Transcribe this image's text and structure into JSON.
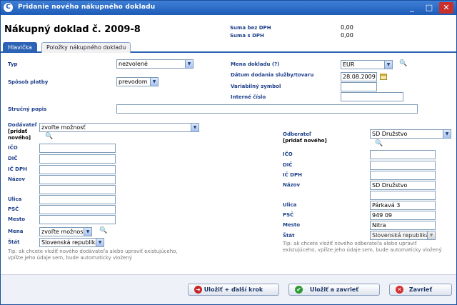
{
  "window": {
    "title": "Pridanie nového nákupného dokladu",
    "logo": "C",
    "minimize": "_",
    "maximize": "□",
    "close": "✕"
  },
  "header": {
    "doc_title": "Nákupný doklad č. 2009-8",
    "sum_without_vat_label": "Suma bez DPH",
    "sum_without_vat_value": "0,00",
    "sum_with_vat_label": "Suma s DPH",
    "sum_with_vat_value": "0,00"
  },
  "tabs": [
    {
      "label": "Hlavička",
      "active": true
    },
    {
      "label": "Položky nákupného dokladu",
      "active": false
    }
  ],
  "form": {
    "type_label": "Typ",
    "type_value": "nezvolené",
    "payment_label": "Spôsob platby",
    "payment_value": "prevodom",
    "currency_label": "Mena dokladu",
    "currency_help": "(?)",
    "currency_value": "EUR",
    "delivery_date_label": "Dátum dodania služby/tovaru",
    "delivery_date_value": "28.08.2009",
    "variable_symbol_label": "Variabilný symbol",
    "variable_symbol_value": "",
    "internal_number_label": "Interné číslo",
    "internal_number_value": "",
    "description_label": "Stručný popis",
    "description_value": ""
  },
  "supplier": {
    "label": "Dodávateľ",
    "add_new": "[pridať nového]",
    "select_value": "zvoľte možnosť",
    "ico_label": "IČO",
    "ico": "",
    "dic_label": "DIČ",
    "dic": "",
    "icdph_label": "IČ DPH",
    "icdph": "",
    "name_label": "Názov",
    "name": "",
    "name2": "",
    "street_label": "Ulica",
    "street": "",
    "psc_label": "PSČ",
    "psc": "",
    "city_label": "Mesto",
    "city": "",
    "currency_label": "Mena",
    "currency_value": "zvoľte možnosť",
    "country_label": "Štát",
    "country_value": "Slovenská republika",
    "tip": "Tip: ak chcete vložiť nového dodávateľa alebo upraviť existujúceho, vpíšte jeho údaje sem, bude automaticky vložený"
  },
  "customer": {
    "label": "Odberateľ",
    "add_new": "[pridať nového]",
    "select_value": "SD Družstvo",
    "ico_label": "IČO",
    "ico": "",
    "dic_label": "DIČ",
    "dic": "",
    "icdph_label": "IČ DPH",
    "icdph": "",
    "name_label": "Názov",
    "name": "SD Družstvo",
    "name2": "",
    "street_label": "Ulica",
    "street": "Párkavá 3",
    "psc_label": "PSČ",
    "psc": "949 09",
    "city_label": "Mesto",
    "city": "Nitra",
    "country_label": "Štát",
    "country_value": "Slovenská republika",
    "tip": "Tip: ak chcete vložiť nového odberateľa alebo upraviť existujúceho, vpíšte jeho údaje sem, bude automaticky vložený"
  },
  "buttons": {
    "save_next": "Uložiť + ďalší krok",
    "save_close": "Uložiť a zavrieť",
    "close": "Zavrieť"
  },
  "icons": {
    "search": "magnifier-icon",
    "calendar": "calendar-icon",
    "arrow_right": "arrow-right-icon",
    "check": "checkmark-icon",
    "close": "close-icon"
  },
  "colors": {
    "titlebar": "#1d5cb7",
    "label": "#1d3f8a",
    "save_next_icon": "#c62828",
    "save_close_icon": "#2e9b36",
    "close_icon": "#d32f2f"
  }
}
